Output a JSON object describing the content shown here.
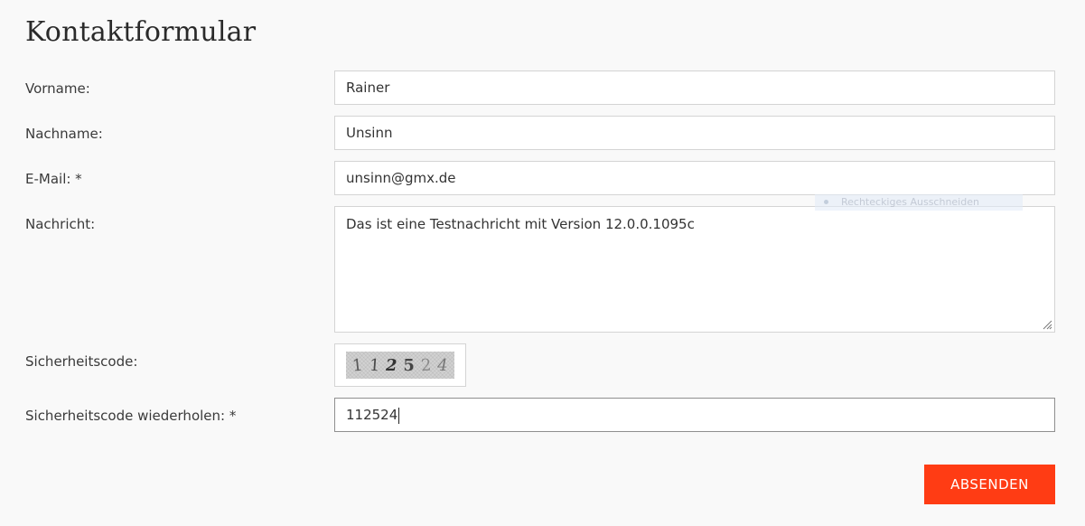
{
  "form": {
    "title": "Kontaktformular",
    "fields": {
      "vorname": {
        "label": "Vorname:",
        "value": "Rainer"
      },
      "nachname": {
        "label": "Nachname:",
        "value": "Unsinn"
      },
      "email": {
        "label": "E-Mail: *",
        "value": "unsinn@gmx.de"
      },
      "nachricht": {
        "label": "Nachricht:",
        "value": "Das ist eine Testnachricht mit Version 12.0.0.1095c"
      },
      "sicherheitscode": {
        "label": "Sicherheitscode:",
        "captcha_chars": [
          "1",
          "1",
          "2",
          "5",
          "2",
          "4"
        ]
      },
      "sicherheitscode_wiederholen": {
        "label": "Sicherheitscode wiederholen: *",
        "value": "112524"
      }
    },
    "submit_label": "ABSENDEN"
  },
  "overlay": {
    "tooltip_text": "Rechteckiges Ausschneiden"
  },
  "colors": {
    "background": "#f9f9f9",
    "accent": "#ff3c14",
    "border": "#d4d4d4"
  }
}
